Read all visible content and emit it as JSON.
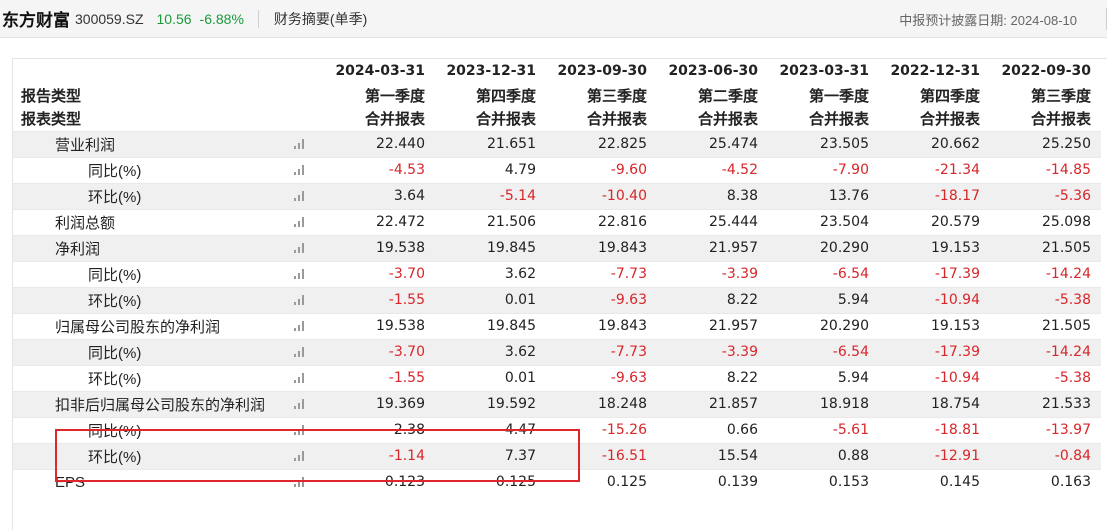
{
  "header": {
    "stock_name": "东方财富",
    "stock_code": "300059.SZ",
    "price": "10.56",
    "change_pct": "-6.88%",
    "section_title": "财务摘要(单季)",
    "disclosure_label": "中报预计披露日期: 2024-08-10"
  },
  "colors": {
    "up_red": "#d8262a",
    "down_green": "#1a9a3a",
    "highlight": "#e0262a"
  },
  "table": {
    "dates": [
      "2024-03-31",
      "2023-12-31",
      "2023-09-30",
      "2023-06-30",
      "2023-03-31",
      "2022-12-31",
      "2022-09-30"
    ],
    "report_type": {
      "label": "报告类型",
      "values": [
        "第一季度",
        "第四季度",
        "第三季度",
        "第二季度",
        "第一季度",
        "第四季度",
        "第三季度"
      ]
    },
    "statement_type": {
      "label": "报表类型",
      "values": [
        "合并报表",
        "合并报表",
        "合并报表",
        "合并报表",
        "合并报表",
        "合并报表",
        "合并报表"
      ]
    },
    "rows": [
      {
        "label": "营业利润",
        "values": [
          "22.440",
          "21.651",
          "22.825",
          "25.474",
          "23.505",
          "20.662",
          "25.250"
        ]
      },
      {
        "label": "同比(%)",
        "values": [
          "-4.53",
          "4.79",
          "-9.60",
          "-4.52",
          "-7.90",
          "-21.34",
          "-14.85"
        ]
      },
      {
        "label": "环比(%)",
        "values": [
          "3.64",
          "-5.14",
          "-10.40",
          "8.38",
          "13.76",
          "-18.17",
          "-5.36"
        ]
      },
      {
        "label": "利润总额",
        "values": [
          "22.472",
          "21.506",
          "22.816",
          "25.444",
          "23.504",
          "20.579",
          "25.098"
        ]
      },
      {
        "label": "净利润",
        "values": [
          "19.538",
          "19.845",
          "19.843",
          "21.957",
          "20.290",
          "19.153",
          "21.505"
        ]
      },
      {
        "label": "同比(%)",
        "values": [
          "-3.70",
          "3.62",
          "-7.73",
          "-3.39",
          "-6.54",
          "-17.39",
          "-14.24"
        ]
      },
      {
        "label": "环比(%)",
        "values": [
          "-1.55",
          "0.01",
          "-9.63",
          "8.22",
          "5.94",
          "-10.94",
          "-5.38"
        ]
      },
      {
        "label": "归属母公司股东的净利润",
        "values": [
          "19.538",
          "19.845",
          "19.843",
          "21.957",
          "20.290",
          "19.153",
          "21.505"
        ]
      },
      {
        "label": "同比(%)",
        "values": [
          "-3.70",
          "3.62",
          "-7.73",
          "-3.39",
          "-6.54",
          "-17.39",
          "-14.24"
        ]
      },
      {
        "label": "环比(%)",
        "values": [
          "-1.55",
          "0.01",
          "-9.63",
          "8.22",
          "5.94",
          "-10.94",
          "-5.38"
        ]
      },
      {
        "label": "扣非后归属母公司股东的净利润",
        "values": [
          "19.369",
          "19.592",
          "18.248",
          "21.857",
          "18.918",
          "18.754",
          "21.533"
        ]
      },
      {
        "label": "同比(%)",
        "values": [
          "2.38",
          "4.47",
          "-15.26",
          "0.66",
          "-5.61",
          "-18.81",
          "-13.97"
        ]
      },
      {
        "label": "环比(%)",
        "values": [
          "-1.14",
          "7.37",
          "-16.51",
          "15.54",
          "0.88",
          "-12.91",
          "-0.84"
        ]
      },
      {
        "label": "EPS",
        "values": [
          "0.123",
          "0.125",
          "0.125",
          "0.139",
          "0.153",
          "0.145",
          "0.163"
        ]
      }
    ],
    "chart_icon": "mini-bar-chart-icon"
  }
}
